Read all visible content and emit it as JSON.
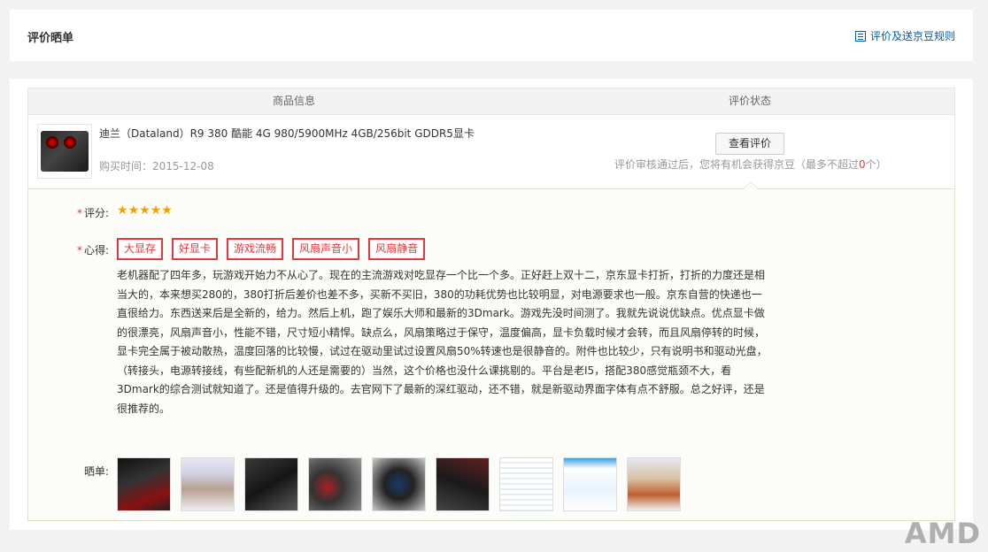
{
  "header": {
    "title": "评价晒单",
    "rules_link": "评价及送京豆规则"
  },
  "table": {
    "col_product": "商品信息",
    "col_status": "评价状态"
  },
  "product": {
    "name": "迪兰（Dataland）R9 380 酷能 4G 980/5900MHz 4GB/256bit GDDR5显卡",
    "purchase_time": "购买时间：2015-12-08",
    "view_button": "查看评价",
    "note_before": "评价审核通过后，您将有机会获得京豆（最多不超过",
    "note_count": "0",
    "note_after": "个）"
  },
  "review": {
    "rating_label": "评分:",
    "rating_value": 5,
    "rating_max": 5,
    "tags_label": "心得:",
    "required_mark": "*",
    "tags": [
      "大显存",
      "好显卡",
      "游戏流畅",
      "风扇声音小",
      "风扇静音"
    ],
    "text": "老机器配了四年多，玩游戏开始力不从心了。现在的主流游戏对吃显存一个比一个多。正好赶上双十二，京东显卡打折，打折的力度还是相当大的，本来想买280的，380打折后差价也差不多，买新不买旧，380的功耗优势也比较明显，对电源要求也一般。京东自营的快递也一直很给力。东西送来后是全新的，给力。然后上机，跑了娱乐大师和最新的3Dmark。游戏先没时间测了。我就先说说优缺点。优点显卡做的很漂亮，风扇声音小，性能不错，尺寸短小精悍。缺点么，风扇策略过于保守，温度偏高，显卡负载时候才会转，而且风扇停转的时候，显卡完全属于被动散热，温度回落的比较慢，试过在驱动里试过设置风扇50%转速也是很静音的。附件也比较少，只有说明书和驱动光盘，（转接头，电源转接线，有些配新机的人还是需要的）当然，这个价格也没什么课挑剔的。平台是老I5，搭配380感觉瓶颈不大，看3Dmark的综合测试就知道了。还是值得升级的。去官网下了最新的深红驱动，还不错，就是新驱动界面字体有点不舒服。总之好评，还是很推荐的。",
    "photos_label": "晒单:",
    "photo_count": 9
  },
  "watermark": "AMD"
}
